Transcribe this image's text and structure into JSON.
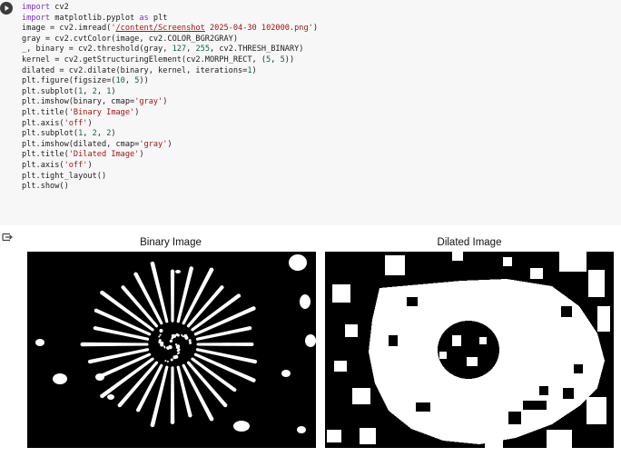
{
  "code_cell": {
    "lines": [
      [
        {
          "t": "import",
          "c": "kw"
        },
        {
          "t": " cv2"
        }
      ],
      [
        {
          "t": "import",
          "c": "kw"
        },
        {
          "t": " matplotlib.pyplot "
        },
        {
          "t": "as",
          "c": "kw"
        },
        {
          "t": " plt"
        }
      ],
      [
        {
          "t": "image = cv2.imread("
        },
        {
          "t": "'",
          "c": "str"
        },
        {
          "t": "/content/Screenshot",
          "c": "str u"
        },
        {
          "t": " 2025-04-30 102000.png'",
          "c": "str"
        },
        {
          "t": ")"
        }
      ],
      [
        {
          "t": "gray = cv2.cvtColor(image, cv2.COLOR_BGR2GRAY)"
        }
      ],
      [
        {
          "t": "_, binary = cv2.threshold(gray, "
        },
        {
          "t": "127",
          "c": "num"
        },
        {
          "t": ", "
        },
        {
          "t": "255",
          "c": "num"
        },
        {
          "t": ", cv2.THRESH_BINARY)"
        }
      ],
      [
        {
          "t": "kernel = cv2.getStructuringElement(cv2.MORPH_RECT, ("
        },
        {
          "t": "5",
          "c": "num"
        },
        {
          "t": ", "
        },
        {
          "t": "5",
          "c": "num"
        },
        {
          "t": "))"
        }
      ],
      [
        {
          "t": "dilated = cv2.dilate(binary, kernel, iterations="
        },
        {
          "t": "1",
          "c": "num"
        },
        {
          "t": ")"
        }
      ],
      [
        {
          "t": "plt.figure(figsize=("
        },
        {
          "t": "10",
          "c": "num"
        },
        {
          "t": ", "
        },
        {
          "t": "5",
          "c": "num"
        },
        {
          "t": "))"
        }
      ],
      [
        {
          "t": "plt.subplot("
        },
        {
          "t": "1",
          "c": "num"
        },
        {
          "t": ", "
        },
        {
          "t": "2",
          "c": "num"
        },
        {
          "t": ", "
        },
        {
          "t": "1",
          "c": "num"
        },
        {
          "t": ")"
        }
      ],
      [
        {
          "t": "plt.imshow(binary, cmap="
        },
        {
          "t": "'gray'",
          "c": "str"
        },
        {
          "t": ")"
        }
      ],
      [
        {
          "t": "plt.title("
        },
        {
          "t": "'Binary Image'",
          "c": "str"
        },
        {
          "t": ")"
        }
      ],
      [
        {
          "t": "plt.axis("
        },
        {
          "t": "'off'",
          "c": "str"
        },
        {
          "t": ")"
        }
      ],
      [
        {
          "t": "plt.subplot("
        },
        {
          "t": "1",
          "c": "num"
        },
        {
          "t": ", "
        },
        {
          "t": "2",
          "c": "num"
        },
        {
          "t": ", "
        },
        {
          "t": "2",
          "c": "num"
        },
        {
          "t": ")"
        }
      ],
      [
        {
          "t": "plt.imshow(dilated, cmap="
        },
        {
          "t": "'gray'",
          "c": "str"
        },
        {
          "t": ")"
        }
      ],
      [
        {
          "t": "plt.title("
        },
        {
          "t": "'Dilated Image'",
          "c": "str"
        },
        {
          "t": ")"
        }
      ],
      [
        {
          "t": "plt.axis("
        },
        {
          "t": "'off'",
          "c": "str"
        },
        {
          "t": ")"
        }
      ],
      [
        {
          "t": "plt.tight_layout()"
        }
      ],
      [
        {
          "t": "plt.show()"
        }
      ]
    ]
  },
  "icons": {
    "run": "play-icon",
    "output_toggle": "output-toggle-icon"
  },
  "output": {
    "left_title": "Binary Image",
    "right_title": "Dilated Image"
  },
  "colors": {
    "cell_bg": "#f7f7f7",
    "keyword": "#7b30d0",
    "string": "#a31515",
    "number": "#116644"
  }
}
